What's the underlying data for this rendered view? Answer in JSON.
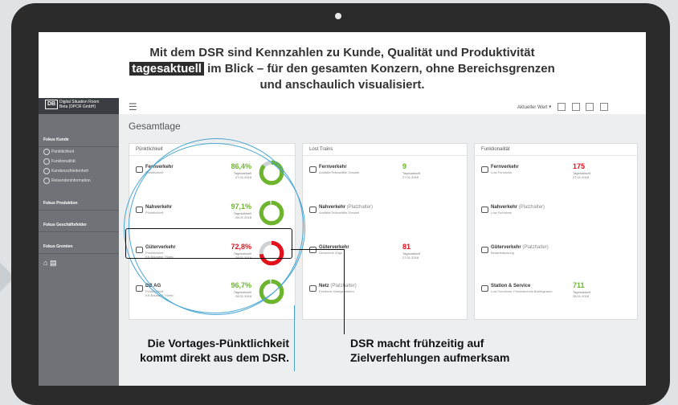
{
  "headline": {
    "line1": "Mit dem DSR sind Kennzahlen zu Kunde, Qualität und Produktivität",
    "highlight": "tagesaktuell",
    "line2_rest": " im Blick – für den gesamten Konzern, ohne Bereichsgrenzen",
    "line3": "und anschaulich visualisiert."
  },
  "app": {
    "logo": "DB",
    "title": "Digital Situation Room",
    "subtitle": "Beta (DPCR GmbH)",
    "page_title": "Gesamtlage",
    "toolbar_select": "Aktueller Wert"
  },
  "sidebar": {
    "sections": [
      {
        "label": "Fokus Kunde",
        "items": [
          "Pünktlichkeit",
          "Funktionalität",
          "Kundenzufriedenheit",
          "Reisendeninformation"
        ]
      },
      {
        "label": "Fokus Produktion",
        "items": []
      },
      {
        "label": "Fokus Geschäftsfelder",
        "items": []
      },
      {
        "label": "Fokus Gremien",
        "items": []
      }
    ]
  },
  "panels": {
    "punkt": {
      "title": "Pünktlichkeit",
      "rows": [
        {
          "name": "Fernverkehr",
          "sub": "Pünktlichkeit",
          "value": "86,4%",
          "label": "Tagesaktuell",
          "date": "27.01.2018",
          "color": "#6cb52d",
          "pct": 0.864
        },
        {
          "name": "Nahverkehr",
          "sub": "Pünktlichkeit",
          "value": "97,1%",
          "label": "Tagesaktuell",
          "date": "28.01.2018",
          "color": "#6cb52d",
          "pct": 0.971
        },
        {
          "name": "Güterverkehr",
          "sub": "Pünktlichkeit",
          "sub2": "KN Baustein \"Horts\"",
          "value": "72,8%",
          "label": "Tagesaktuell",
          "date": "28.01.2018",
          "color": "#e3111b",
          "pct": 0.728
        },
        {
          "name": "DB AG",
          "sub": "Pünktlichkeit",
          "sub2": "KN Baustein \"Horts\"",
          "value": "96,7%",
          "label": "Tagesaktuell",
          "date": "28.01.2018",
          "color": "#6cb52d",
          "pct": 0.967
        }
      ]
    },
    "lost": {
      "title": "Lost Trains",
      "rows": [
        {
          "name": "Fernverkehr",
          "ph": "",
          "sub": "Ausfälle/Teilausfälle Gesamt",
          "value": "9",
          "label": "Tagesaktuell",
          "date": "27.01.2018",
          "color": "#6cb52d"
        },
        {
          "name": "Nahverkehr",
          "ph": "(Platzhalter)",
          "sub": "Ausfälle/Teilausfälle Gesamt",
          "value": "",
          "label": "",
          "date": "",
          "color": "#333"
        },
        {
          "name": "Güterverkehr",
          "ph": "",
          "sub": "Gefahrene Züge",
          "value": "81",
          "label": "Tagesaktuell",
          "date": "27.01.2018",
          "color": "#e3111b"
        },
        {
          "name": "Netz",
          "ph": "(Platzhalter)",
          "sub": "Fehlende Gelegenheiten",
          "value": "",
          "label": "",
          "date": "",
          "color": "#333"
        }
      ]
    },
    "funk": {
      "title": "Funktionalität",
      "rows": [
        {
          "name": "Fernverkehr",
          "ph": "",
          "sub": "Lost Functions",
          "value": "175",
          "label": "Tagesaktuell",
          "date": "27.01.2018",
          "color": "#e3111b"
        },
        {
          "name": "Nahverkehr",
          "ph": "(Platzhalter)",
          "sub": "Lost Functions",
          "value": "",
          "label": "",
          "date": "",
          "color": "#333"
        },
        {
          "name": "Güterverkehr",
          "ph": "(Platzhalter)",
          "sub": "Bedarfsdeckung",
          "value": "",
          "label": "",
          "date": "",
          "color": "#333"
        },
        {
          "name": "Station & Service",
          "ph": "",
          "sub": "Lost Functions: Fördertechnik Bahnsgraum",
          "value": "711",
          "label": "Tagesaktuell",
          "date": "28.01.2018",
          "color": "#6cb52d"
        }
      ]
    }
  },
  "captions": {
    "left1": "Die Vortages-Pünktlichkeit",
    "left2": "kommt direkt aus dem DSR.",
    "right1": "DSR macht frühzeitig auf",
    "right2": "Zielverfehlungen aufmerksam"
  }
}
